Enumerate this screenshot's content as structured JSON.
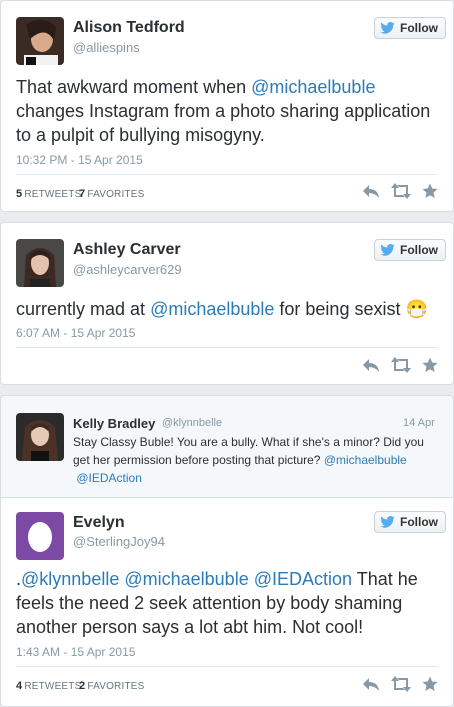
{
  "follow_label": "Follow",
  "tweet1": {
    "name": "Alison Tedford",
    "handle": "@alliespins",
    "text_pre": "That awkward moment when ",
    "mention": "@michaelbuble",
    "text_post": " changes Instagram from a photo sharing application to a pulpit of bullying misogyny.",
    "timestamp": "10:32 PM - 15 Apr 2015",
    "retweets_count": "5",
    "retweets_label": "RETWEETS",
    "favorites_count": "7",
    "favorites_label": "FAVORITES"
  },
  "tweet2": {
    "name": "Ashley Carver",
    "handle": "@ashleycarver629",
    "text_pre": "currently mad at ",
    "mention": "@michaelbuble",
    "text_post": " for being sexist ",
    "emoji": "😷",
    "timestamp": "6:07 AM - 15 Apr 2015"
  },
  "tweet3": {
    "name": "Kelly Bradley",
    "handle": "@klynnbelle",
    "date": "14 Apr",
    "text": "Stay Classy Buble! You are a bully. What if she's a minor? Did you get her permission before posting that picture? ",
    "mention1": "@michaelbuble",
    "mention2": "@IEDAction"
  },
  "tweet4": {
    "name": "Evelyn",
    "handle": "@SterlingJoy94",
    "prefix": ".",
    "mention1": "@klynnbelle",
    "mention2": "@michaelbuble",
    "mention3": "@IEDAction",
    "text_post": " That he feels the need 2 seek attention by body shaming another person says a lot abt  him. Not cool!",
    "timestamp": "1:43 AM - 15 Apr 2015",
    "retweets_count": "4",
    "retweets_label": "RETWEETS",
    "favorites_count": "2",
    "favorites_label": "FAVORITES"
  },
  "icons": [
    "twitter-bird-icon",
    "reply-icon",
    "retweet-icon",
    "favorite-icon",
    "egg-avatar-icon"
  ],
  "colors": {
    "link": "#2b7bb9",
    "egg_bg": "#7c49a4",
    "bird": "#55acee"
  }
}
